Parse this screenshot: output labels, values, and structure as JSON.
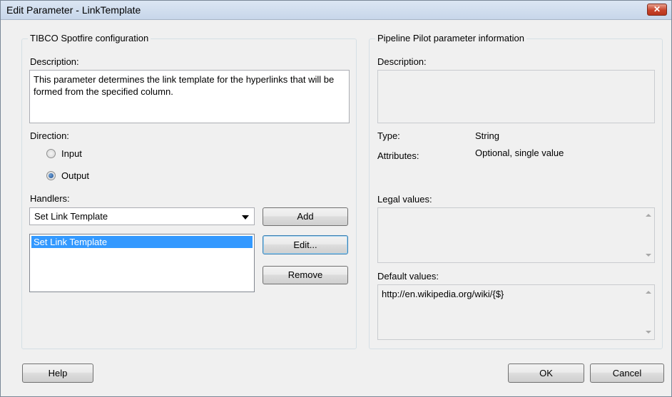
{
  "window": {
    "title": "Edit Parameter - LinkTemplate",
    "close_icon": "close-icon"
  },
  "spotfire": {
    "group_title": "TIBCO Spotfire configuration",
    "description_label": "Description:",
    "description_value": "This parameter determines the link template for the hyperlinks that will be formed from the specified column.",
    "direction_label": "Direction:",
    "direction_options": [
      "Input",
      "Output"
    ],
    "direction_selected": "Output",
    "handlers_label": "Handlers:",
    "handler_selected": "Set Link Template",
    "handler_list": [
      "Set Link Template"
    ],
    "add_label": "Add",
    "edit_label": "Edit...",
    "remove_label": "Remove"
  },
  "pipeline": {
    "group_title": "Pipeline Pilot parameter information",
    "description_label": "Description:",
    "description_value": "",
    "type_label": "Type:",
    "type_value": "String",
    "attributes_label": "Attributes:",
    "attributes_value": "Optional, single value",
    "legal_values_label": "Legal values:",
    "legal_values_value": "",
    "default_values_label": "Default values:",
    "default_values_value": "http://en.wikipedia.org/wiki/{$}"
  },
  "footer": {
    "help_label": "Help",
    "ok_label": "OK",
    "cancel_label": "Cancel"
  },
  "colors": {
    "selection": "#3399ff",
    "focus_border": "#3c7fb1",
    "close_button": "#c7432a"
  }
}
